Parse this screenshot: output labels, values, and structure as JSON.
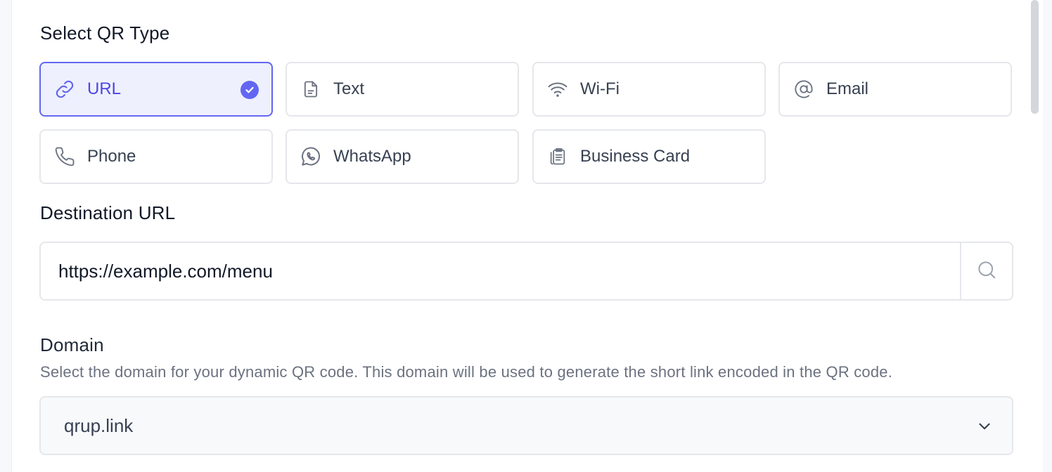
{
  "qr_type": {
    "heading": "Select QR Type",
    "options": [
      {
        "label": "URL",
        "icon": "link-icon",
        "selected": true
      },
      {
        "label": "Text",
        "icon": "document-icon",
        "selected": false
      },
      {
        "label": "Wi-Fi",
        "icon": "wifi-icon",
        "selected": false
      },
      {
        "label": "Email",
        "icon": "at-sign-icon",
        "selected": false
      },
      {
        "label": "Phone",
        "icon": "phone-icon",
        "selected": false
      },
      {
        "label": "WhatsApp",
        "icon": "whatsapp-icon",
        "selected": false
      },
      {
        "label": "Business Card",
        "icon": "clipboard-icon",
        "selected": false
      }
    ]
  },
  "destination": {
    "heading": "Destination URL",
    "value": "https://example.com/menu"
  },
  "domain": {
    "heading": "Domain",
    "help_text": "Select the domain for your dynamic QR code. This domain will be used to generate the short link encoded in the QR code.",
    "selected": "qrup.link"
  },
  "colors": {
    "accent": "#6366f1",
    "selected_bg": "#eef0fd",
    "border": "#e5e7eb",
    "muted_text": "#6b7280"
  }
}
